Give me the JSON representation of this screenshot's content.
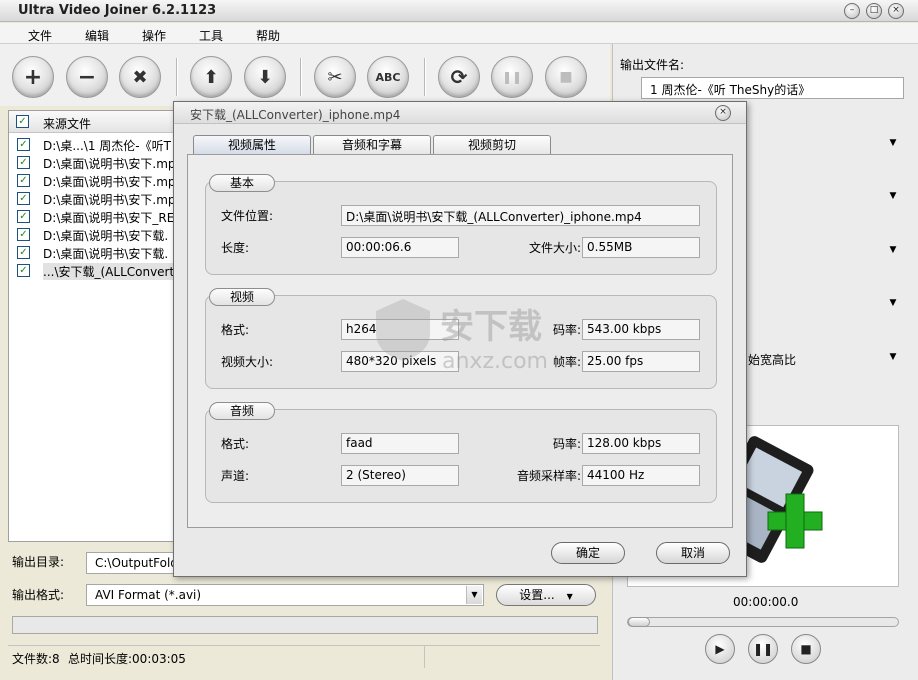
{
  "app": {
    "title": "Ultra Video Joiner 6.2.1123",
    "window_controls": [
      "minimize-icon",
      "maximize-icon",
      "close-icon"
    ]
  },
  "menu": [
    "文件",
    "编辑",
    "操作",
    "工具",
    "帮助"
  ],
  "toolbar": {
    "buttons": [
      {
        "name": "add-icon",
        "glyph": "+"
      },
      {
        "name": "remove-icon",
        "glyph": "−"
      },
      {
        "name": "clear-icon",
        "glyph": "✖"
      },
      {
        "name": "move-up-icon",
        "glyph": "⬆"
      },
      {
        "name": "move-down-icon",
        "glyph": "⬇"
      },
      {
        "name": "cut-icon",
        "glyph": "✂"
      },
      {
        "name": "rename-abc-icon",
        "glyph": "ABC"
      },
      {
        "name": "convert-icon",
        "glyph": "⟳"
      },
      {
        "name": "pause-icon",
        "glyph": "❚❚"
      },
      {
        "name": "stop-icon",
        "glyph": "■"
      }
    ]
  },
  "filelist": {
    "header": "来源文件",
    "files": [
      "D:\\桌...\\1 周杰伦-《听T",
      "D:\\桌面\\说明书\\安下.mp",
      "D:\\桌面\\说明书\\安下.mp",
      "D:\\桌面\\说明书\\安下.mp",
      "D:\\桌面\\说明书\\安下_RE",
      "D:\\桌面\\说明书\\安下载.",
      "D:\\桌面\\说明书\\安下载.",
      "...\\安下载_(ALLConvert"
    ]
  },
  "output": {
    "dir_label": "输出目录:",
    "dir_value": "C:\\OutputFold",
    "format_label": "输出格式:",
    "format_value": "AVI Format (*.avi)",
    "settings_label": "设置..."
  },
  "status": {
    "file_count": "文件数:8",
    "total_duration": "总时间长度:00:03:05"
  },
  "right": {
    "output_name_label": "输出文件名:",
    "output_name_value": "1 周杰伦-《听 TheShy的话》",
    "aspect_option": "始宽高比",
    "time": "00:00:00.0"
  },
  "dialog": {
    "title": "安下载_(ALLConverter)_iphone.mp4",
    "tabs": [
      "视频属性",
      "音频和字幕",
      "视频剪切"
    ],
    "basic": {
      "title": "基本",
      "location_label": "文件位置:",
      "location_value": "D:\\桌面\\说明书\\安下载_(ALLConverter)_iphone.mp4",
      "length_label": "长度:",
      "length_value": "00:00:06.6",
      "size_label": "文件大小:",
      "size_value": "0.55MB"
    },
    "video": {
      "title": "视频",
      "format_label": "格式:",
      "format_value": "h264",
      "bitrate_label": "码率:",
      "bitrate_value": "543.00 kbps",
      "dims_label": "视频大小:",
      "dims_value": "480*320 pixels",
      "fps_label": "帧率:",
      "fps_value": "25.00 fps"
    },
    "audio": {
      "title": "音频",
      "format_label": "格式:",
      "format_value": "faad",
      "bitrate_label": "码率:",
      "bitrate_value": "128.00 kbps",
      "channels_label": "声道:",
      "channels_value": "2 (Stereo)",
      "samplerate_label": "音频采样率:",
      "samplerate_value": "44100 Hz"
    },
    "ok": "确定",
    "cancel": "取消"
  },
  "watermark": {
    "brand": "安下载",
    "url": "anxz.com"
  }
}
